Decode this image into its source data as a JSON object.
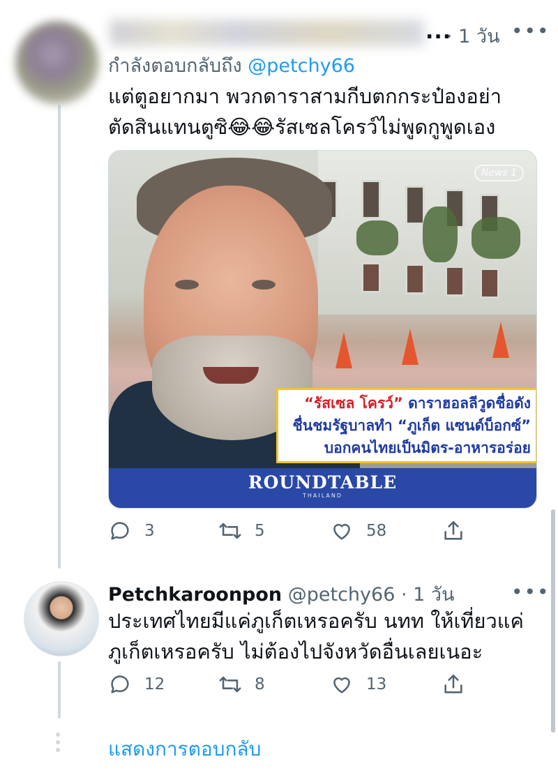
{
  "tweet1": {
    "timestamp": "· 1 วัน",
    "reply_prefix": "กำลังตอบกลับถึง",
    "reply_handle": "@petchy66",
    "text": "แต่ตูอยากมา พวกดาราสามกีบตกกระป๋องอย่า\nตัดสินแทนตูซิ😂😂รัสเซลโครว์ไม่พูดกูพูดเอง",
    "media": {
      "watermark": "News 1",
      "caption_line1_quote": "“รัสเซล โครว์”",
      "caption_line1_rest": " ดาราฮอลลีวูดชื่อดัง",
      "caption_line2_part1": "ชื่นชมรัฐบาลทำ ",
      "caption_line2_quote": "“ภูเก็ต แซนด์บ็อกซ์”",
      "caption_line3": "บอกคนไทยเป็นมิตร-อาหารอร่อย",
      "brand": "ROUNDTABLE",
      "brand_sub": "THAILAND"
    },
    "stats": {
      "replies": "3",
      "retweets": "5",
      "likes": "58"
    }
  },
  "tweet2": {
    "display_name": "Petchkaroonpon",
    "handle": "@petchy66",
    "timestamp": "· 1 วัน",
    "text": "ประเทศไทยมีแค่ภูเก็ตเหรอครับ นทท ให้เที่ยวแค่\nภูเก็ตเหรอครับ ไม่ต้องไปจังหวัดอื่นเลยเนอะ",
    "stats": {
      "replies": "12",
      "retweets": "8",
      "likes": "13"
    }
  },
  "show_replies": "แสดงการตอบกลับ",
  "more_icon": "•••",
  "colors": {
    "link": "#1d9bf0",
    "muted": "#536471",
    "brand_blue": "#2a48a5"
  }
}
